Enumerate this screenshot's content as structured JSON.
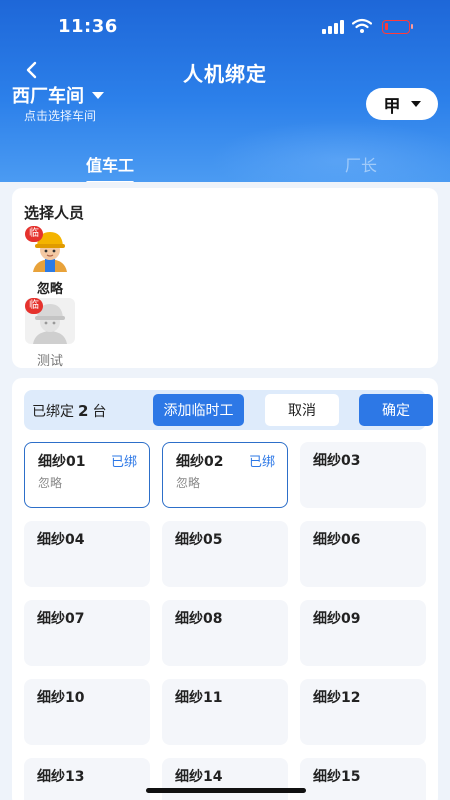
{
  "status_bar": {
    "time": "11:36"
  },
  "header": {
    "title": "人机绑定",
    "workshop": "西厂车间",
    "workshop_hint": "点击选择车间",
    "shift": "甲"
  },
  "tabs": [
    {
      "label": "值车工",
      "active": true
    },
    {
      "label": "厂长",
      "active": false
    }
  ],
  "person_section": {
    "title": "选择人员",
    "temp_badge": "临",
    "people": [
      {
        "name": "忽略",
        "temporary": true,
        "active": true
      },
      {
        "name": "测试",
        "temporary": true,
        "active": false
      }
    ]
  },
  "machine_panel": {
    "bound_prefix": "已绑定",
    "bound_count": "2",
    "bound_suffix": "台",
    "add_temp_label": "添加临时工",
    "cancel_label": "取消",
    "confirm_label": "确定",
    "machines": [
      {
        "name": "细纱01",
        "status": "已绑",
        "operator": "忽略"
      },
      {
        "name": "细纱02",
        "status": "已绑",
        "operator": "忽略"
      },
      {
        "name": "细纱03",
        "status": "",
        "operator": ""
      },
      {
        "name": "细纱04",
        "status": "",
        "operator": ""
      },
      {
        "name": "细纱05",
        "status": "",
        "operator": ""
      },
      {
        "name": "细纱06",
        "status": "",
        "operator": ""
      },
      {
        "name": "细纱07",
        "status": "",
        "operator": ""
      },
      {
        "name": "细纱08",
        "status": "",
        "operator": ""
      },
      {
        "name": "细纱09",
        "status": "",
        "operator": ""
      },
      {
        "name": "细纱10",
        "status": "",
        "operator": ""
      },
      {
        "name": "细纱11",
        "status": "",
        "operator": ""
      },
      {
        "name": "细纱12",
        "status": "",
        "operator": ""
      },
      {
        "name": "细纱13",
        "status": "",
        "operator": ""
      },
      {
        "name": "细纱14",
        "status": "",
        "operator": ""
      },
      {
        "name": "细纱15",
        "status": "",
        "operator": ""
      }
    ]
  },
  "colors": {
    "primary": "#2d78e6",
    "header_top": "#1e67d8",
    "badge": "#e5322d",
    "bound_border": "#2d6fc9"
  }
}
